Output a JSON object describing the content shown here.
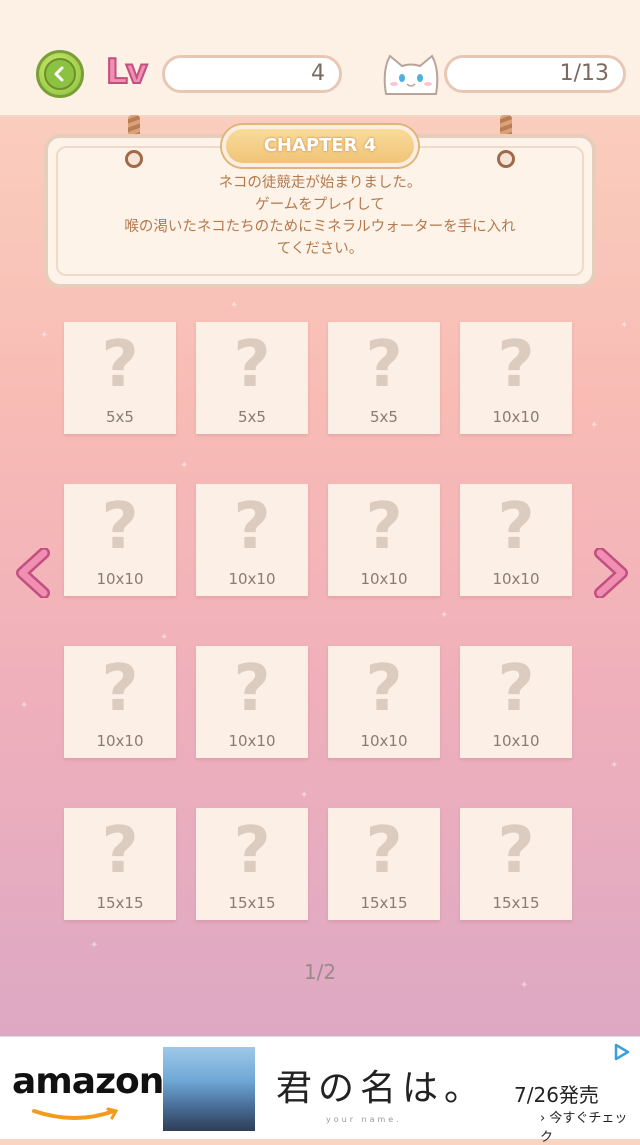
{
  "header": {
    "level_label": "Lv",
    "level_value": "4",
    "cats_value": "1/13",
    "back_icon": "chevron-left-icon",
    "cat_icon": "cat-face-icon"
  },
  "chapter": {
    "title": "CHAPTER 4",
    "lines": [
      "ネコの徒競走が始まりました。",
      "ゲームをプレイして",
      "喉の渇いたネコたちのためにミネラルウォーターを手に入れ",
      "てください。"
    ]
  },
  "puzzles": [
    {
      "label": "?",
      "size": "5x5"
    },
    {
      "label": "?",
      "size": "5x5"
    },
    {
      "label": "?",
      "size": "5x5"
    },
    {
      "label": "?",
      "size": "10x10"
    },
    {
      "label": "?",
      "size": "10x10"
    },
    {
      "label": "?",
      "size": "10x10"
    },
    {
      "label": "?",
      "size": "10x10"
    },
    {
      "label": "?",
      "size": "10x10"
    },
    {
      "label": "?",
      "size": "10x10"
    },
    {
      "label": "?",
      "size": "10x10"
    },
    {
      "label": "?",
      "size": "10x10"
    },
    {
      "label": "?",
      "size": "10x10"
    },
    {
      "label": "?",
      "size": "15x15"
    },
    {
      "label": "?",
      "size": "15x15"
    },
    {
      "label": "?",
      "size": "15x15"
    },
    {
      "label": "?",
      "size": "15x15"
    }
  ],
  "pagination": {
    "current": "1/2"
  },
  "ad": {
    "brand": "amazon",
    "title": "君の名は。",
    "subtitle": "your name.",
    "release": "7/26発売",
    "cta": "今すぐチェック"
  },
  "colors": {
    "accent_pink": "#f08fb1",
    "back_green": "#8cc241",
    "chapter_gold": "#f0c379"
  }
}
